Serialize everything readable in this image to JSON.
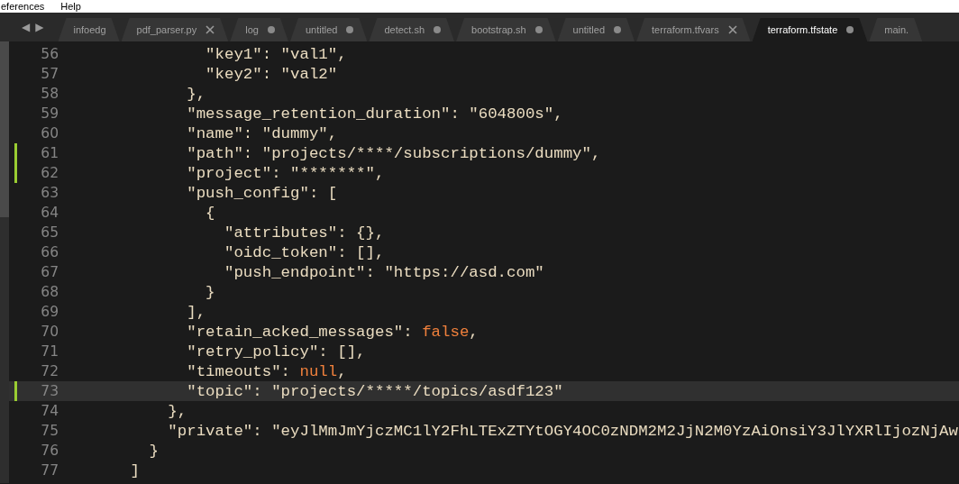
{
  "menu_bar": {
    "items": [
      "eferences",
      "Help"
    ]
  },
  "tab_bar": {
    "nav": [
      "◀",
      "▶"
    ],
    "tabs": [
      {
        "label": "infoedg",
        "selected": false
      },
      {
        "label": "pdf_parser.py",
        "selected": false,
        "modified": false
      },
      {
        "label": "log",
        "selected": false,
        "modified": true
      },
      {
        "label": "untitled",
        "selected": false,
        "modified": true
      },
      {
        "label": "detect.sh",
        "selected": false,
        "modified": true
      },
      {
        "label": "bootstrap.sh",
        "selected": false,
        "modified": true
      },
      {
        "label": "untitled",
        "selected": false,
        "modified": true
      },
      {
        "label": "terraform.tfvars",
        "selected": false,
        "modified": false
      },
      {
        "label": "terraform.tfstate",
        "selected": true,
        "modified": true
      },
      {
        "label": "main.",
        "selected": false
      }
    ]
  },
  "editor": {
    "lines": [
      {
        "number": "56",
        "modified": false,
        "current": false,
        "segments": [
          {
            "kind": "plain",
            "text": "              \"key1\": \"val1\","
          }
        ]
      },
      {
        "number": "57",
        "modified": false,
        "current": false,
        "segments": [
          {
            "kind": "plain",
            "text": "              \"key2\": \"val2\""
          }
        ]
      },
      {
        "number": "58",
        "modified": false,
        "current": false,
        "segments": [
          {
            "kind": "plain",
            "text": "            },"
          }
        ]
      },
      {
        "number": "59",
        "modified": false,
        "current": false,
        "segments": [
          {
            "kind": "plain",
            "text": "            \"message_retention_duration\": \"604800s\","
          }
        ]
      },
      {
        "number": "60",
        "modified": false,
        "current": false,
        "segments": [
          {
            "kind": "plain",
            "text": "            \"name\": \"dummy\","
          }
        ]
      },
      {
        "number": "61",
        "modified": true,
        "current": false,
        "segments": [
          {
            "kind": "plain",
            "text": "            \"path\": \"projects/****/subscriptions/dummy\","
          }
        ]
      },
      {
        "number": "62",
        "modified": true,
        "current": false,
        "segments": [
          {
            "kind": "plain",
            "text": "            \"project\": \"*******\","
          }
        ]
      },
      {
        "number": "63",
        "modified": false,
        "current": false,
        "segments": [
          {
            "kind": "plain",
            "text": "            \"push_config\": ["
          }
        ]
      },
      {
        "number": "64",
        "modified": false,
        "current": false,
        "segments": [
          {
            "kind": "plain",
            "text": "              {"
          }
        ]
      },
      {
        "number": "65",
        "modified": false,
        "current": false,
        "segments": [
          {
            "kind": "plain",
            "text": "                \"attributes\": {},"
          }
        ]
      },
      {
        "number": "66",
        "modified": false,
        "current": false,
        "segments": [
          {
            "kind": "plain",
            "text": "                \"oidc_token\": [],"
          }
        ]
      },
      {
        "number": "67",
        "modified": false,
        "current": false,
        "segments": [
          {
            "kind": "plain",
            "text": "                \"push_endpoint\": \"https://asd.com\""
          }
        ]
      },
      {
        "number": "68",
        "modified": false,
        "current": false,
        "segments": [
          {
            "kind": "plain",
            "text": "              }"
          }
        ]
      },
      {
        "number": "69",
        "modified": false,
        "current": false,
        "segments": [
          {
            "kind": "plain",
            "text": "            ],"
          }
        ]
      },
      {
        "number": "70",
        "modified": false,
        "current": false,
        "segments": [
          {
            "kind": "plain",
            "text": "            \"retain_acked_messages\": "
          },
          {
            "kind": "literal",
            "text": "false"
          },
          {
            "kind": "plain",
            "text": ","
          }
        ]
      },
      {
        "number": "71",
        "modified": false,
        "current": false,
        "segments": [
          {
            "kind": "plain",
            "text": "            \"retry_policy\": [],"
          }
        ]
      },
      {
        "number": "72",
        "modified": false,
        "current": false,
        "segments": [
          {
            "kind": "plain",
            "text": "            \"timeouts\": "
          },
          {
            "kind": "literal",
            "text": "null"
          },
          {
            "kind": "plain",
            "text": ","
          }
        ]
      },
      {
        "number": "73",
        "modified": true,
        "current": true,
        "segments": [
          {
            "kind": "plain",
            "text": "            \"topic\": \"projects/*****/topics/asdf123\""
          }
        ]
      },
      {
        "number": "74",
        "modified": false,
        "current": false,
        "segments": [
          {
            "kind": "plain",
            "text": "          },"
          }
        ]
      },
      {
        "number": "75",
        "modified": false,
        "current": false,
        "segments": [
          {
            "kind": "plain",
            "text": "          \"private\": \"eyJlMmJmYjczMC1lY2FhLTExZTYtOGY4OC0zNDM2M2JjN2M0YzAiOnsiY3JlYXRlIjozNjAw"
          }
        ]
      },
      {
        "number": "76",
        "modified": false,
        "current": false,
        "segments": [
          {
            "kind": "plain",
            "text": "        }"
          }
        ]
      },
      {
        "number": "77",
        "modified": false,
        "current": false,
        "segments": [
          {
            "kind": "plain",
            "text": "      ]"
          }
        ]
      }
    ]
  }
}
